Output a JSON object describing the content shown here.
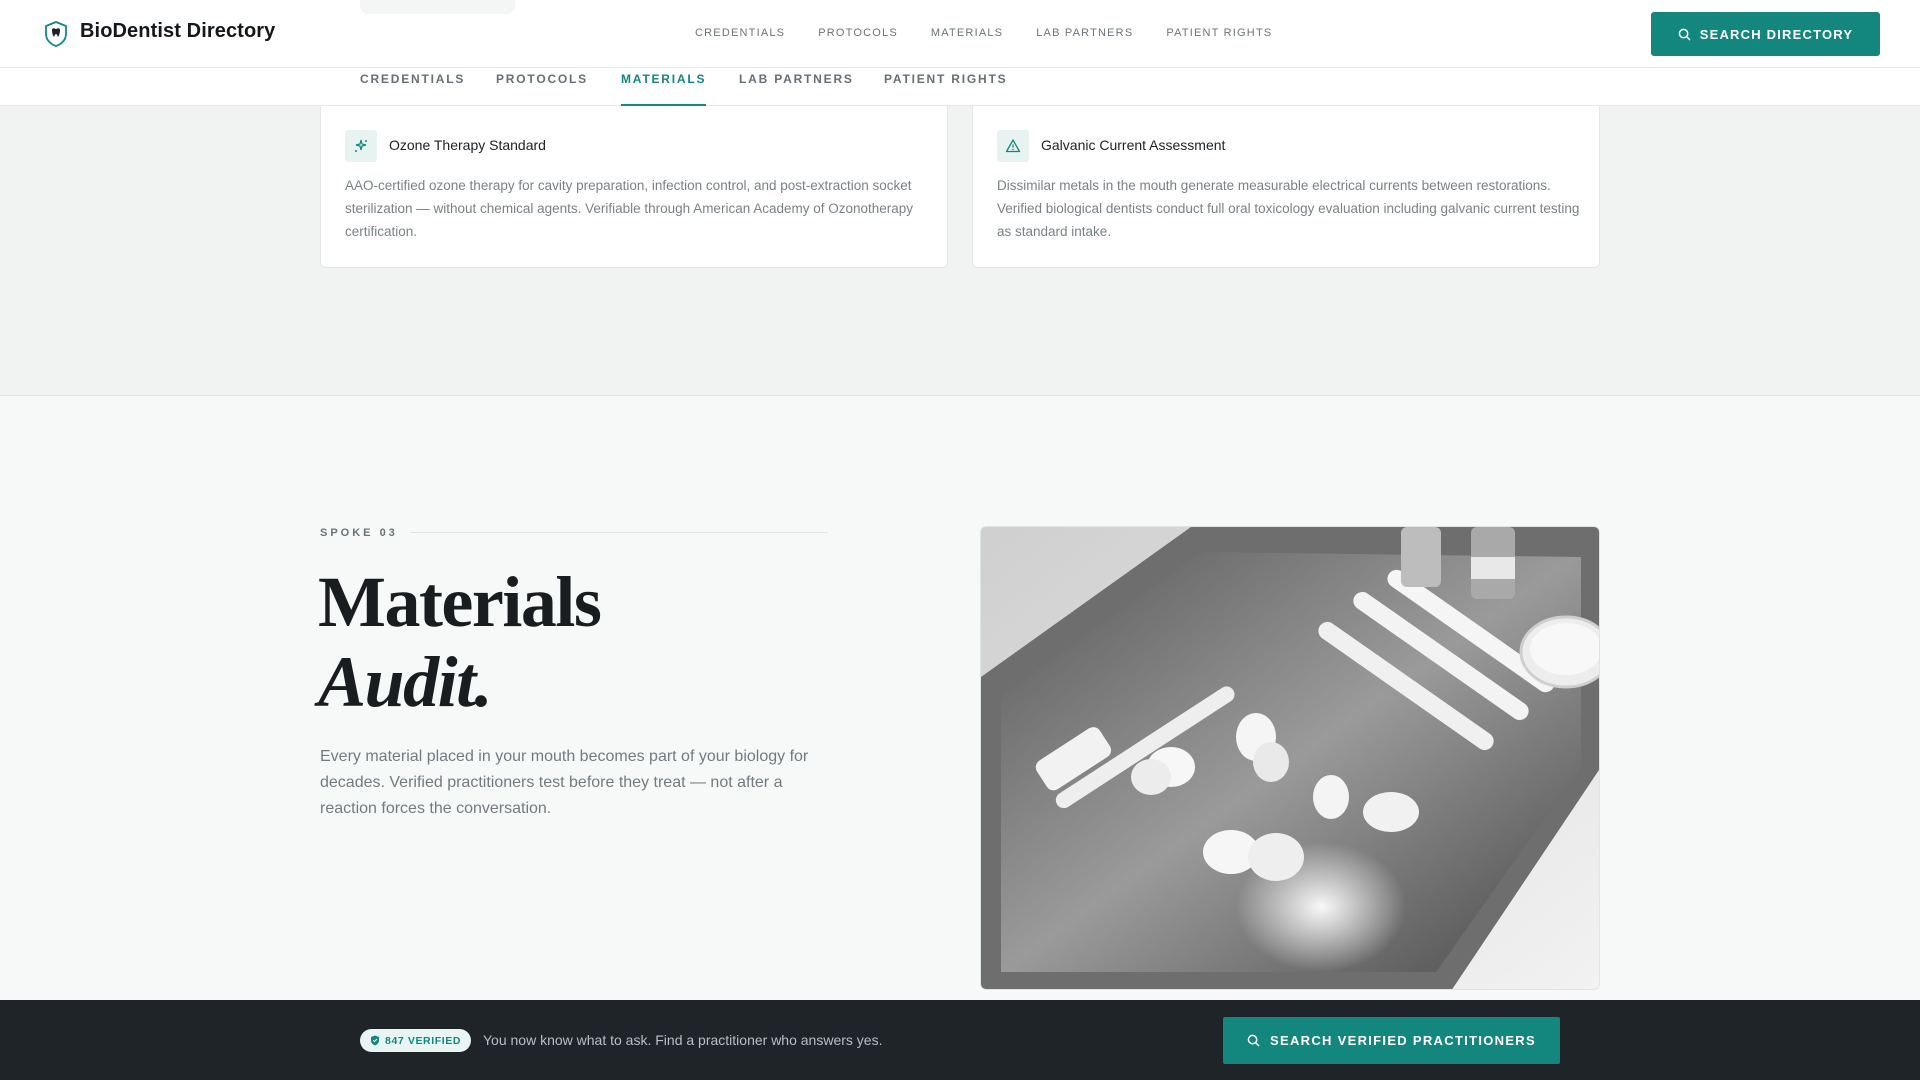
{
  "header": {
    "brand": "BioDentist Directory",
    "logo_icon": "tooth-shield-icon",
    "nav": [
      "CREDENTIALS",
      "PROTOCOLS",
      "MATERIALS",
      "LAB PARTNERS",
      "PATIENT RIGHTS"
    ],
    "search_button": "SEARCH DIRECTORY",
    "search_icon": "search-icon"
  },
  "subnav": {
    "items": [
      "CREDENTIALS",
      "PROTOCOLS",
      "MATERIALS",
      "LAB PARTNERS",
      "PATIENT RIGHTS"
    ],
    "active": "MATERIALS"
  },
  "cards": [
    {
      "icon": "sparkle-icon",
      "title": "Ozone Therapy Standard",
      "text": "AAO-certified ozone therapy for cavity preparation, infection control, and post-extraction socket sterilization — without chemical agents. Verifiable through American Academy of Ozonotherapy certification."
    },
    {
      "icon": "warning-triangle-icon",
      "title": "Galvanic Current Assessment",
      "text": "Dissimilar metals in the mouth generate measurable electrical currents between restorations. Verified biological dentists conduct full oral toxicology evaluation including galvanic current testing as standard intake."
    }
  ],
  "section": {
    "eyebrow": "SPOKE 03",
    "heading_line1": "Materials",
    "heading_line2": "Audit.",
    "body": "Every material placed in your mouth becomes part of your biology for decades. Verified practitioners test before they treat — not after a reaction forces the conversation."
  },
  "bottom_bar": {
    "badge": "847 VERIFIED",
    "message": "You now know what to ask. Find a practitioner who answers yes.",
    "button": "SEARCH VERIFIED PRACTITIONERS"
  },
  "colors": {
    "accent": "#13877d",
    "dark_bar": "#1f2429"
  }
}
